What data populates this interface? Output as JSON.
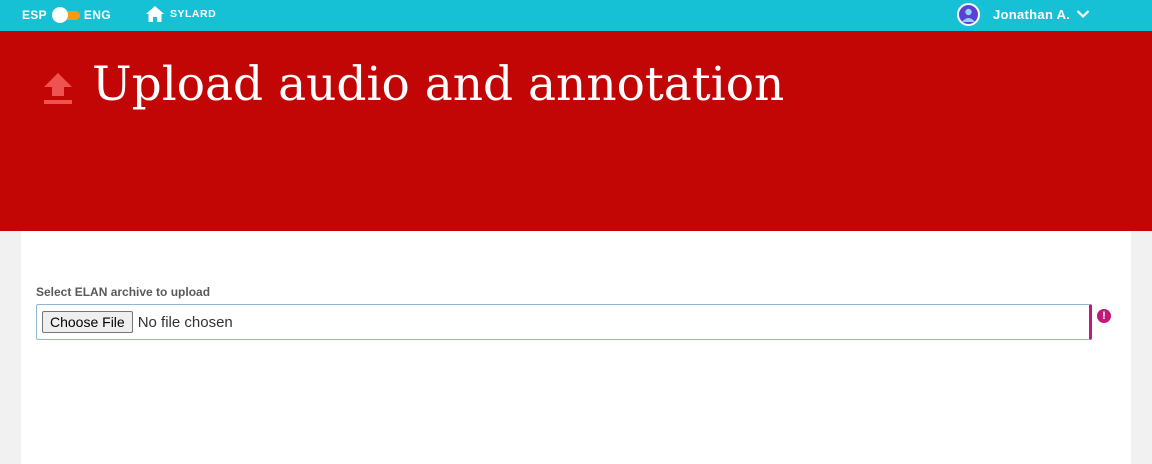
{
  "topbar": {
    "lang_left": "ESP",
    "lang_right": "ENG",
    "home_label": "SYLARD",
    "user_name": "Jonathan A.",
    "colors": {
      "bar": "#17c1d5",
      "toggle": "#f39c12"
    }
  },
  "header": {
    "title": "Upload audio and annotation",
    "icon": "upload-icon",
    "color": "#c20606"
  },
  "form": {
    "label": "Select ELAN archive to upload",
    "button_label": "Choose File",
    "status_text": "No file chosen",
    "error_icon": "!",
    "accent": "#c2187a"
  }
}
